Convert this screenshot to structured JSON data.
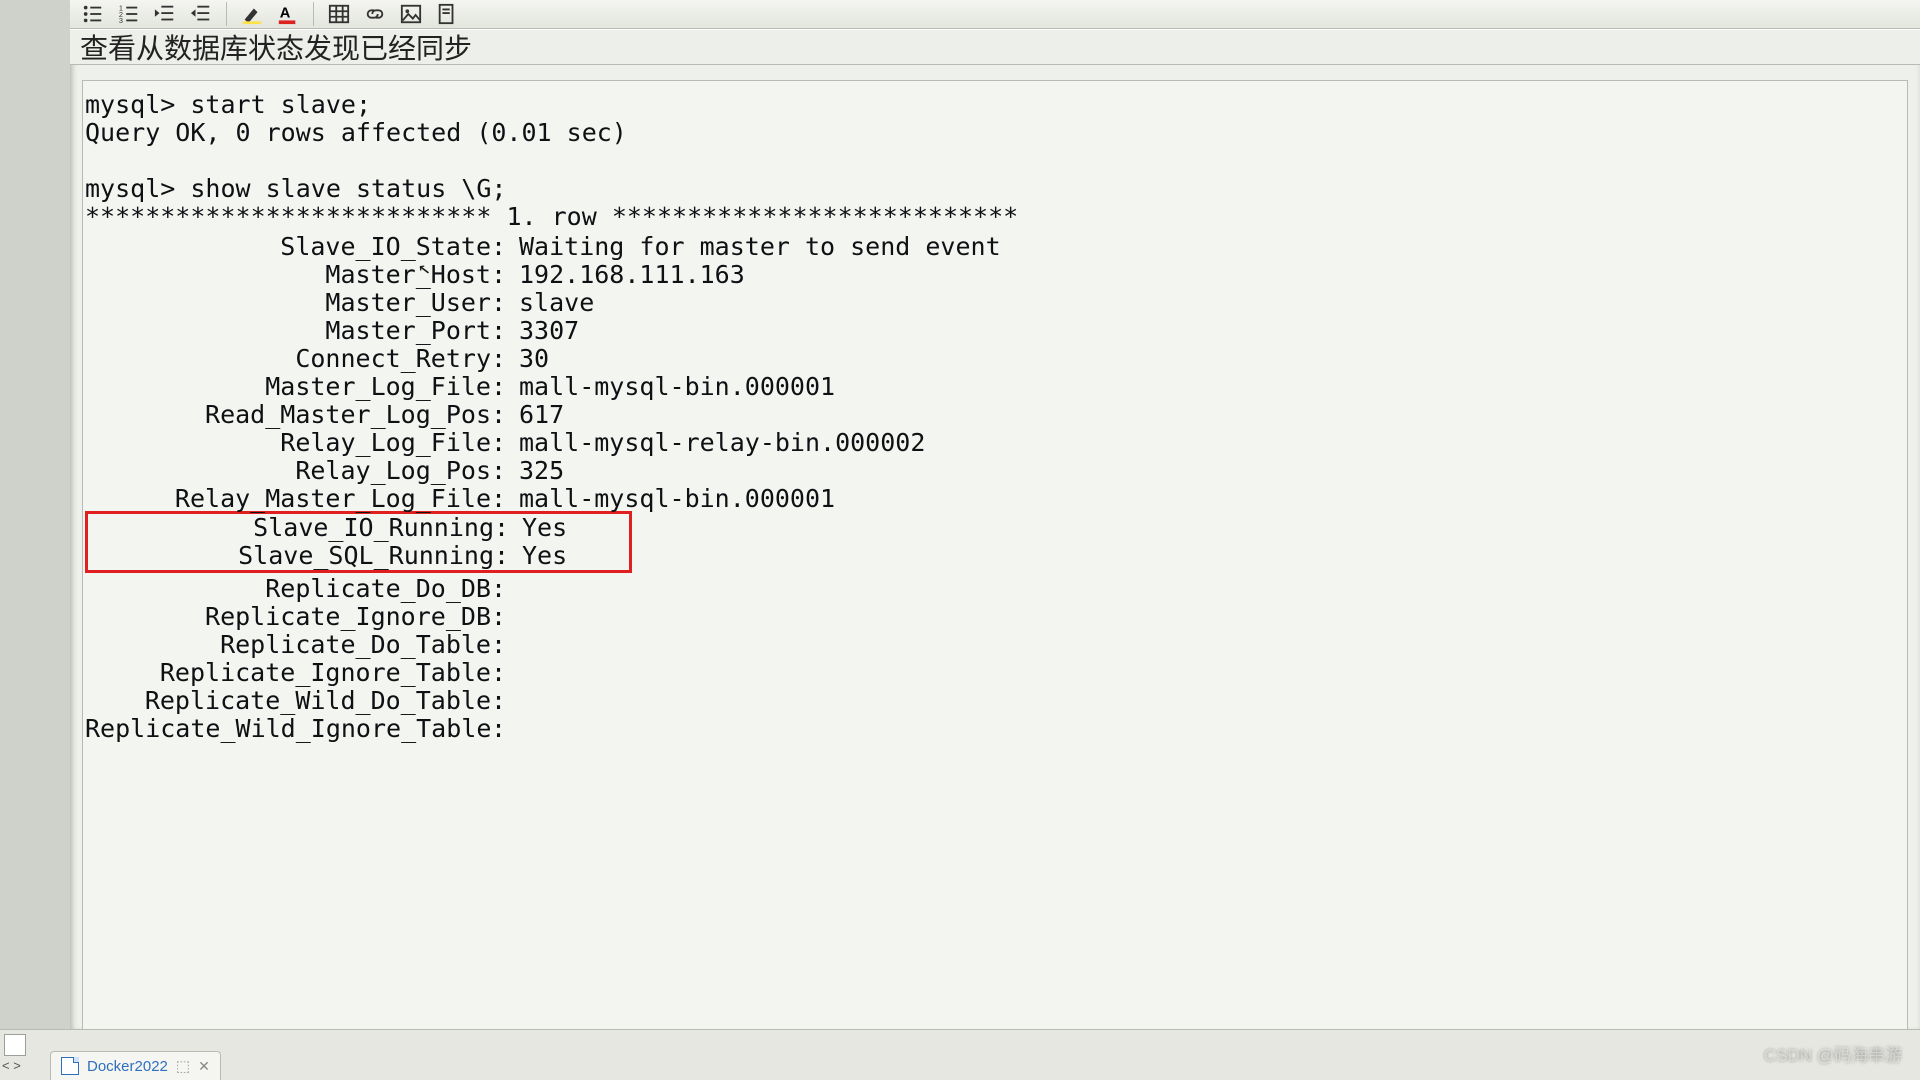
{
  "heading": "查看从数据库状态发现已经同步",
  "cmd1_prompt": "mysql>",
  "cmd1": "start slave;",
  "cmd1_result": "Query OK, 0 rows affected (0.01 sec)",
  "cmd2_prompt": "mysql>",
  "cmd2": "show slave status \\G;",
  "row_sep_left": "***************************",
  "row_sep_mid": "1. row",
  "row_sep_right": "***************************",
  "status": [
    {
      "k": "Slave_IO_State",
      "v": "Waiting for master to send event"
    },
    {
      "k": "Master_Host",
      "v": "192.168.111.163"
    },
    {
      "k": "Master_User",
      "v": "slave"
    },
    {
      "k": "Master_Port",
      "v": "3307"
    },
    {
      "k": "Connect_Retry",
      "v": "30"
    },
    {
      "k": "Master_Log_File",
      "v": "mall-mysql-bin.000001"
    },
    {
      "k": "Read_Master_Log_Pos",
      "v": "617"
    },
    {
      "k": "Relay_Log_File",
      "v": "mall-mysql-relay-bin.000002"
    },
    {
      "k": "Relay_Log_Pos",
      "v": "325"
    },
    {
      "k": "Relay_Master_Log_File",
      "v": "mall-mysql-bin.000001"
    }
  ],
  "highlight": [
    {
      "k": "Slave_IO_Running",
      "v": "Yes"
    },
    {
      "k": "Slave_SQL_Running",
      "v": "Yes"
    }
  ],
  "status2": [
    {
      "k": "Replicate_Do_DB",
      "v": ""
    },
    {
      "k": "Replicate_Ignore_DB",
      "v": ""
    },
    {
      "k": "Replicate_Do_Table",
      "v": ""
    },
    {
      "k": "Replicate_Ignore_Table",
      "v": ""
    },
    {
      "k": "Replicate_Wild_Do_Table",
      "v": ""
    },
    {
      "k": "Replicate_Wild_Ignore_Table",
      "v": ""
    }
  ],
  "tab_label": "Docker2022",
  "watermark": "CSDN @码海串游"
}
